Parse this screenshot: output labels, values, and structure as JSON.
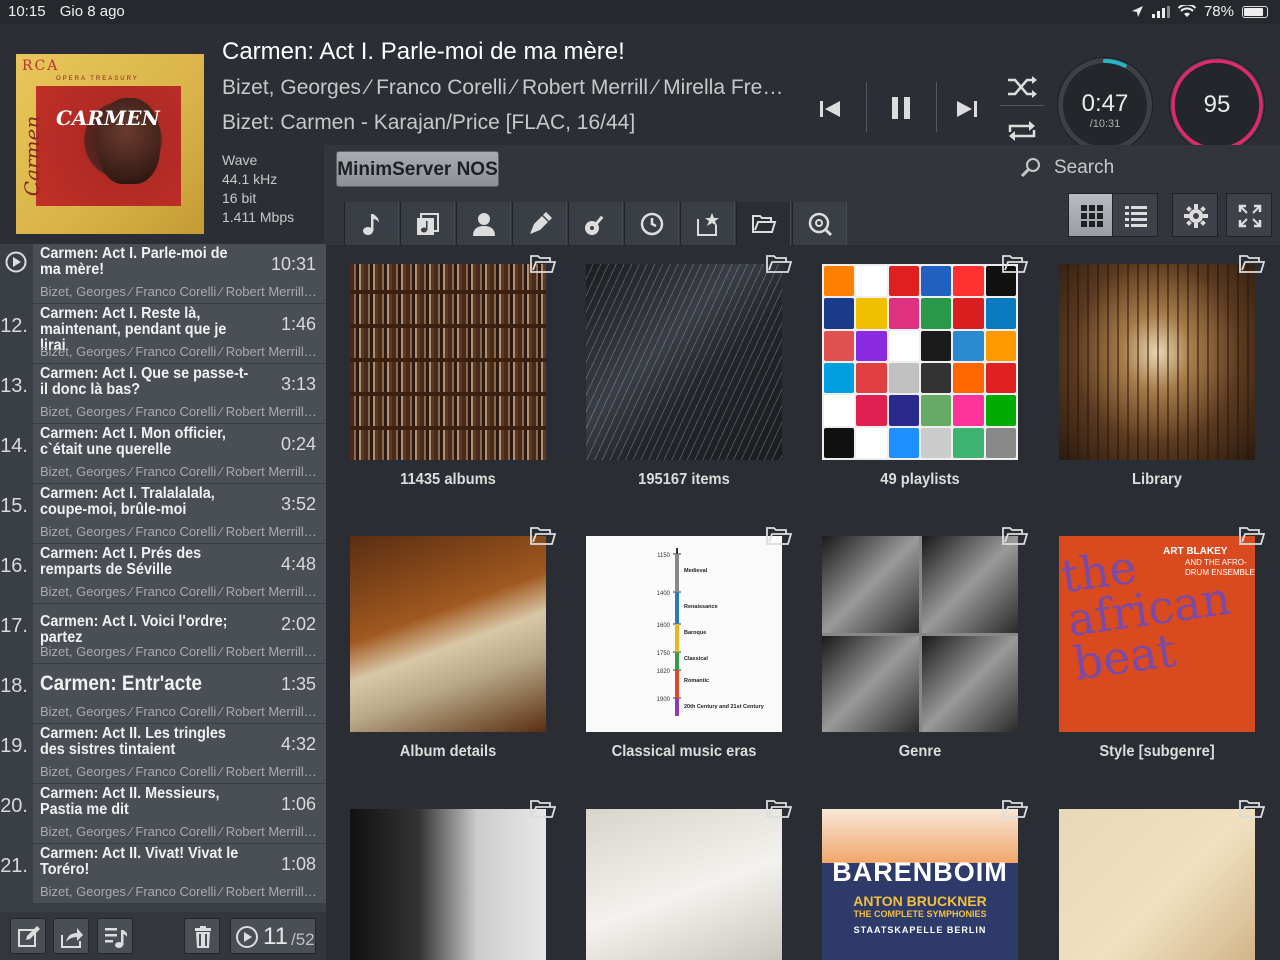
{
  "status": {
    "time": "10:15",
    "date": "Gio 8 ago",
    "battery": "78%"
  },
  "now_playing": {
    "title": "Carmen: Act I. Parle-moi de ma mère!",
    "artists": "Bizet, Georges  ⁄  Franco Corelli  ⁄  Robert Merrill  ⁄  Mirella Freni  ⁄  Karajan",
    "album": "Bizet: Carmen - Karajan/Price [FLAC, 16/44]",
    "format": [
      "Wave",
      "44.1 kHz",
      "16 bit",
      "1.411 Mbps"
    ],
    "elapsed": "0:47",
    "total": "/10:31",
    "progress": 0.074,
    "volume": "95",
    "cover_text": {
      "brand": "RCA",
      "series": "OPERA TREASURY",
      "title": "CARMEN",
      "side": "Carmen"
    }
  },
  "source": {
    "label": "MinimServer NOS"
  },
  "search": {
    "label": "Search"
  },
  "categories": [
    "music-note-icon",
    "album-icon",
    "artist-icon",
    "composer-pen-icon",
    "guitar-icon",
    "clock-icon",
    "star-folder-icon",
    "folder-icon",
    "search-disc-icon"
  ],
  "queue": [
    {
      "num": "",
      "title": "Carmen: Act I. Parle-moi de ma mère!",
      "duration": "10:31",
      "sub": "Bizet, Georges  ⁄  Franco Corelli  ⁄  Robert Merrill  ⁄  Mirella Freni",
      "playing": true
    },
    {
      "num": "12.",
      "title": "Carmen: Act I. Reste là, maintenant, pendant que je lirai",
      "duration": "1:46",
      "sub": "Bizet, Georges  ⁄  Franco Corelli  ⁄  Robert Merrill  ⁄  Mirella Freni"
    },
    {
      "num": "13.",
      "title": "Carmen: Act I. Que se passe-t-il donc là bas?",
      "duration": "3:13",
      "sub": "Bizet, Georges  ⁄  Franco Corelli  ⁄  Robert Merrill  ⁄  Mirella Freni"
    },
    {
      "num": "14.",
      "title": "Carmen: Act I. Mon officier, c`était une querelle",
      "duration": "0:24",
      "sub": "Bizet, Georges  ⁄  Franco Corelli  ⁄  Robert Merrill  ⁄  Mirella Freni"
    },
    {
      "num": "15.",
      "title": "Carmen: Act I. Tralalalala, coupe-moi, brûle-moi",
      "duration": "3:52",
      "sub": "Bizet, Georges  ⁄  Franco Corelli  ⁄  Robert Merrill  ⁄  Mirella Freni"
    },
    {
      "num": "16.",
      "title": "Carmen: Act I. Prés des remparts de Séville",
      "duration": "4:48",
      "sub": "Bizet, Georges  ⁄  Franco Corelli  ⁄  Robert Merrill  ⁄  Mirella Freni"
    },
    {
      "num": "17.",
      "title": "Carmen: Act I. Voici l'ordre; partez",
      "duration": "2:02",
      "sub": "Bizet, Georges  ⁄  Franco Corelli  ⁄  Robert Merrill  ⁄  Mirella Freni",
      "single": true
    },
    {
      "num": "18.",
      "title": "Carmen: Entr'acte",
      "duration": "1:35",
      "sub": "Bizet, Georges  ⁄  Franco Corelli  ⁄  Robert Merrill  ⁄  Mirella Freni",
      "big": true
    },
    {
      "num": "19.",
      "title": "Carmen: Act II. Les tringles des sistres tintaient",
      "duration": "4:32",
      "sub": "Bizet, Georges  ⁄  Franco Corelli  ⁄  Robert Merrill  ⁄  Mirella Freni"
    },
    {
      "num": "20.",
      "title": "Carmen: Act II. Messieurs, Pastia me dit",
      "duration": "1:06",
      "sub": "Bizet, Georges  ⁄  Franco Corelli  ⁄  Robert Merrill  ⁄  Mirella Freni"
    },
    {
      "num": "21.",
      "title": "Carmen: Act II. Vivat! Vivat le Toréro!",
      "duration": "1:08",
      "sub": "Bizet, Georges  ⁄  Franco Corelli  ⁄  Robert Merrill  ⁄  Mirella Freni"
    }
  ],
  "queue_counter": {
    "current": "11",
    "total": "/52"
  },
  "tiles": [
    {
      "label": "11435 albums",
      "art": "art-albums"
    },
    {
      "label": "195167 items",
      "art": "art-items"
    },
    {
      "label": "49 playlists",
      "art": "art-playlists"
    },
    {
      "label": "Library",
      "art": "art-library"
    },
    {
      "label": "Album details",
      "art": "art-details"
    },
    {
      "label": "Classical music eras",
      "art": "art-eras"
    },
    {
      "label": "Genre",
      "art": "art-genre"
    },
    {
      "label": "Style [subgenre]",
      "art": "art-style"
    },
    {
      "label": "",
      "art": "art-bach"
    },
    {
      "label": "",
      "art": "art-score"
    },
    {
      "label": "",
      "art": "art-barenboim"
    },
    {
      "label": "",
      "art": "art-mozart"
    }
  ],
  "eras": {
    "years": [
      "1150",
      "1400",
      "1600",
      "1750",
      "1820",
      "1900"
    ],
    "names": [
      "Medieval",
      "Renaissance",
      "Baroque",
      "Classical",
      "Romantic",
      "20th Century and 21st Century"
    ]
  },
  "style_art": {
    "artist": "ART BLAKEY",
    "subtitle": "AND THE AFRO-DRUM ENSEMBLE",
    "title": "the african beat"
  },
  "barenboim_art": {
    "name": "BARENBOIM",
    "line1": "ANTON BRUCKNER",
    "line2": "THE COMPLETE SYMPHONIES",
    "line3": "STAATSKAPELLE BERLIN"
  },
  "colors": {
    "accent_teal": "#25b6c8",
    "accent_pink": "#e0286a"
  }
}
